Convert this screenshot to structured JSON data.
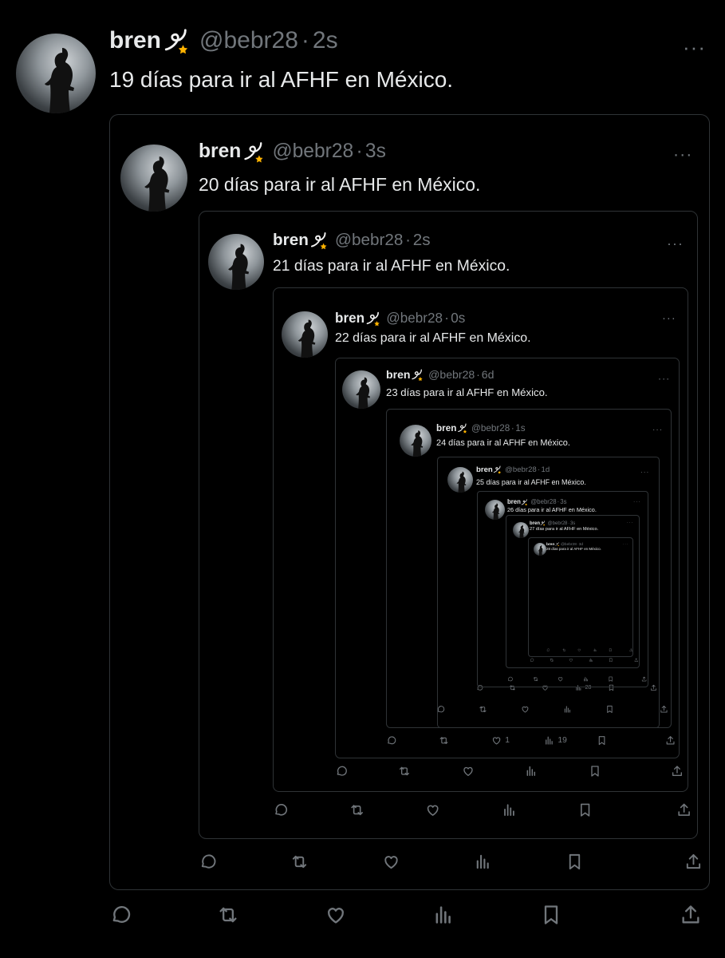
{
  "colors": {
    "background": "#000000",
    "text": "#e7e9ea",
    "muted": "#71767b",
    "border": "#2f3336"
  },
  "icons": {
    "name_emoji": "dizzy-emoji",
    "more": "more-horizontal-icon",
    "reply": "reply-icon",
    "retweet": "retweet-icon",
    "like": "heart-icon",
    "views": "views-icon",
    "bookmark": "bookmark-icon",
    "share": "share-icon"
  },
  "tweets": [
    {
      "name": "bren",
      "handle": "@bebr28",
      "sep": "·",
      "time": "2s",
      "text": "19 días para ir al AFHF en México.",
      "more": "···",
      "likes": "",
      "views": ""
    },
    {
      "name": "bren",
      "handle": "@bebr28",
      "sep": "·",
      "time": "3s",
      "text": "20 días para ir al AFHF en México.",
      "more": "···",
      "likes": "",
      "views": ""
    },
    {
      "name": "bren",
      "handle": "@bebr28",
      "sep": "·",
      "time": "2s",
      "text": "21 días para ir al AFHF en México.",
      "more": "···",
      "likes": "",
      "views": ""
    },
    {
      "name": "bren",
      "handle": "@bebr28",
      "sep": "·",
      "time": "0s",
      "text": "22 días para ir al AFHF en México.",
      "more": "···",
      "likes": "",
      "views": ""
    },
    {
      "name": "bren",
      "handle": "@bebr28",
      "sep": "·",
      "time": "6d",
      "text": "23 días para ir al AFHF en México.",
      "more": "···",
      "likes": "1",
      "views": "19"
    },
    {
      "name": "bren",
      "handle": "@bebr28",
      "sep": "·",
      "time": "1s",
      "text": "24 días para ir al AFHF en México.",
      "more": "···",
      "likes": "",
      "views": ""
    },
    {
      "name": "bren",
      "handle": "@bebr28",
      "sep": "·",
      "time": "1d",
      "text": "25 días para ir al AFHF en México.",
      "more": "···",
      "likes": "",
      "views": "28"
    },
    {
      "name": "bren",
      "handle": "@bebr28",
      "sep": "·",
      "time": "3s",
      "text": "26 días para ir al AFHF en México.",
      "more": "···",
      "likes": "",
      "views": ""
    },
    {
      "name": "bren",
      "handle": "@bebr28",
      "sep": "·",
      "time": "3s",
      "text": "27 días para ir al AFHF en México.",
      "more": "···",
      "likes": "",
      "views": ""
    },
    {
      "name": "bren",
      "handle": "@bebr28",
      "sep": "·",
      "time": "3d",
      "text": "28 días para ir al AFHF en México.",
      "more": "···",
      "likes": "",
      "views": ""
    }
  ]
}
